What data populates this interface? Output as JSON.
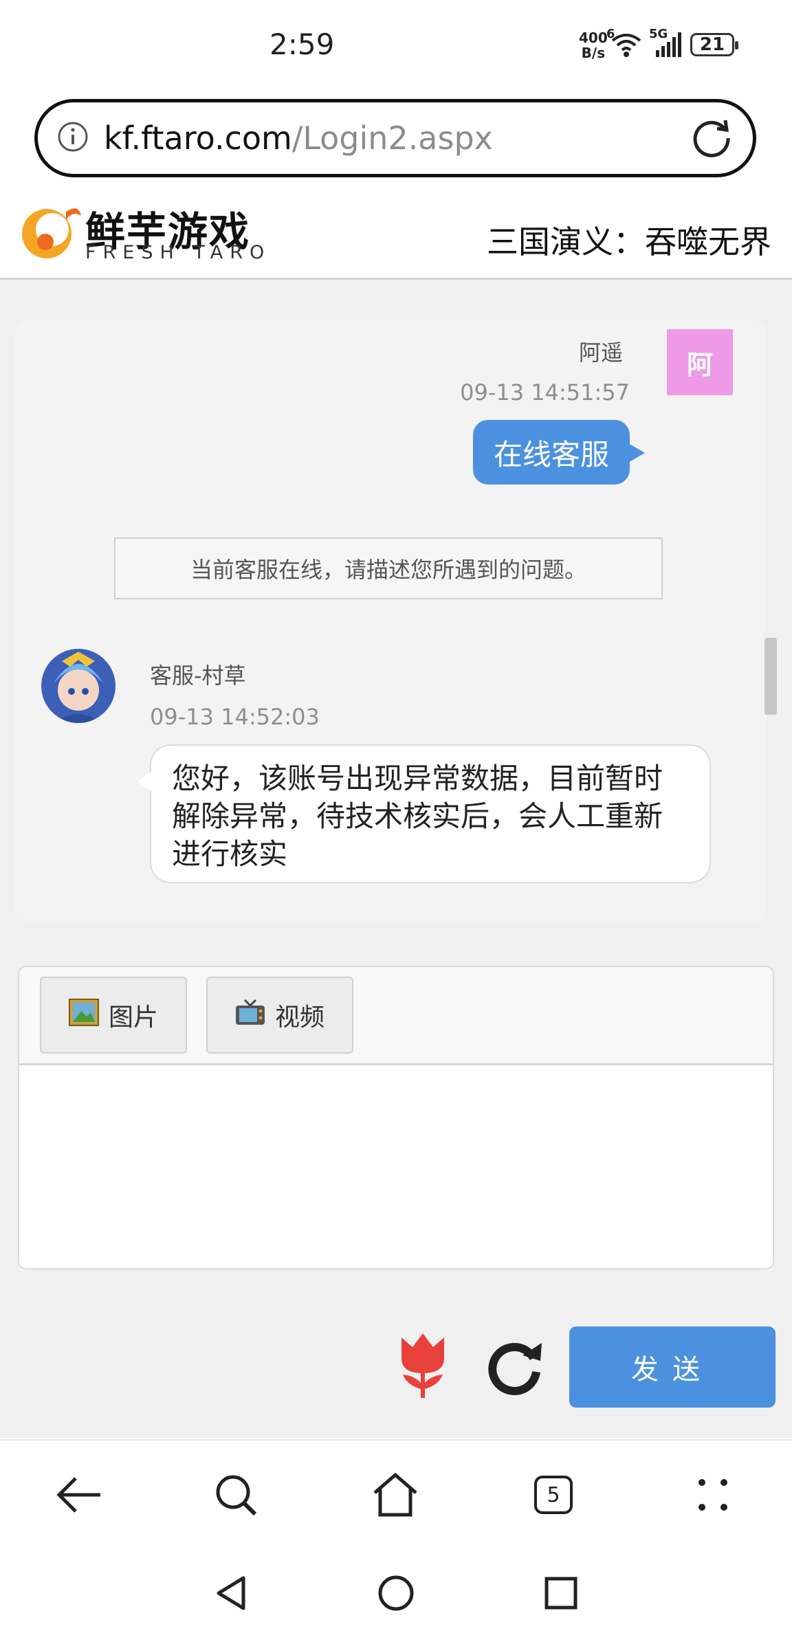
{
  "status_bar": {
    "time": "2:59",
    "speed_value": "400",
    "speed_unit": "B/s",
    "wifi_label": "6",
    "network": "5G",
    "battery": "21"
  },
  "url_bar": {
    "domain": "kf.ftaro.com",
    "path": "/Login2.aspx"
  },
  "site_header": {
    "logo_cn": "鲜芋游戏",
    "logo_en": "FRESH TARO",
    "game_title": "三国演义：吞噬无界",
    "logo_color": "#f5a524"
  },
  "chat": {
    "user_message": {
      "avatar_char": "阿",
      "name": "阿遥",
      "time": "09-13 14:51:57",
      "text": "在线客服"
    },
    "notice": "当前客服在线，请描述您所遇到的问题。",
    "agent_message": {
      "name": "客服-村草",
      "time": "09-13 14:52:03",
      "text": "您好，该账号出现异常数据，目前暂时解除异常，待技术核实后，会人工重新进行核实"
    }
  },
  "composer": {
    "image_label": "图片",
    "video_label": "视频",
    "input_value": ""
  },
  "actions": {
    "send_label": "发送"
  },
  "browser_nav": {
    "tabs_count": "5"
  },
  "colors": {
    "accent": "#4b91e0",
    "user_avatar": "#ee9ae6",
    "tulip": "#e8413c"
  }
}
